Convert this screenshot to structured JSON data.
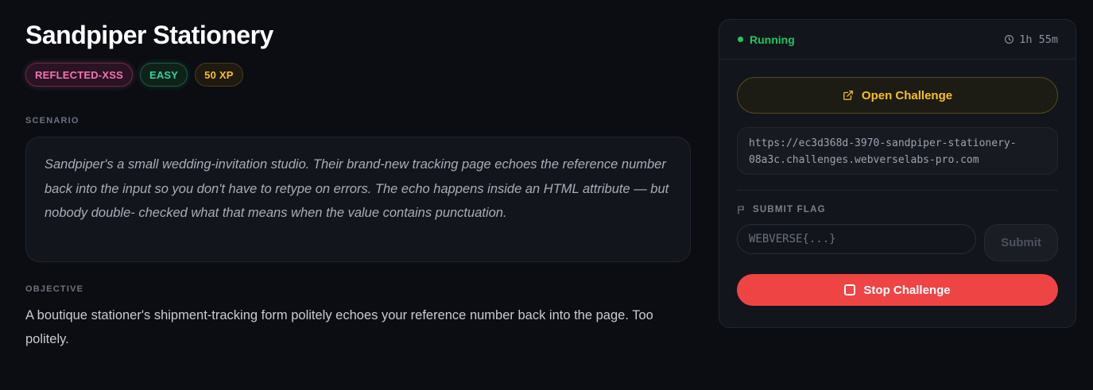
{
  "challenge": {
    "title": "Sandpiper Stationery",
    "tags": {
      "category": "REFLECTED-XSS",
      "difficulty": "EASY",
      "xp": "50 XP"
    },
    "scenario_label": "SCENARIO",
    "scenario_text": "Sandpiper's a small wedding-invitation studio. Their brand-new tracking page echoes the reference number back into the input so you don't have to retype on errors. The echo happens inside an HTML attribute — but nobody double- checked what that means when the value contains punctuation.",
    "objective_label": "OBJECTIVE",
    "objective_text": "A boutique stationer's shipment-tracking form politely echoes your reference number back into the page. Too politely."
  },
  "panel": {
    "status": "Running",
    "timer": "1h 55m",
    "open_button": "Open Challenge",
    "url_line1": "https://ec3d368d-3970-sandpiper-stationery-",
    "url_line2": "08a3c.challenges.webverselabs-pro.com",
    "submit_label": "SUBMIT FLAG",
    "flag_placeholder": "WEBVERSE{...}",
    "submit_button": "Submit",
    "stop_button": "Stop Challenge"
  },
  "colors": {
    "background": "#0b0d12",
    "running": "#22c55e",
    "accent": "#fbbf24",
    "stop": "#ef4444",
    "xss": "#f472b6",
    "easy": "#34d399"
  },
  "icons": {
    "timer": "clock-icon",
    "open": "external-link-icon",
    "flag": "flag-icon",
    "stop": "stop-icon"
  }
}
